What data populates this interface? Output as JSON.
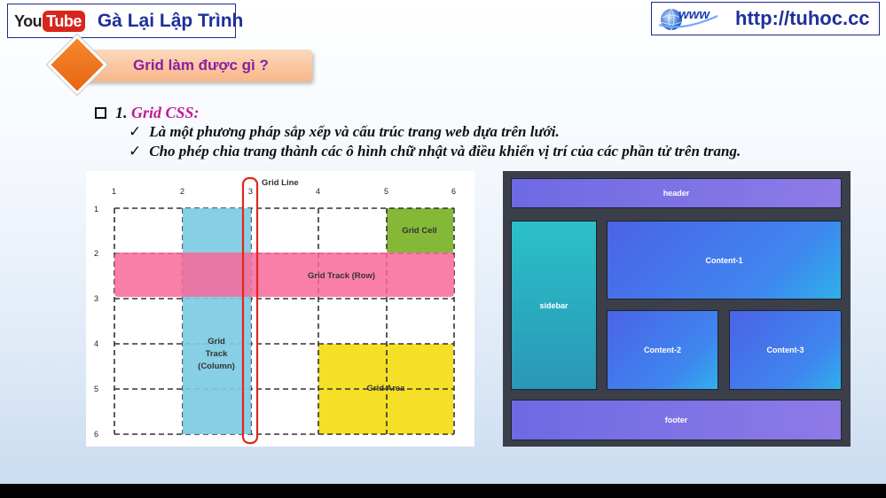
{
  "header": {
    "youtube_you": "You",
    "youtube_tube": "Tube",
    "channel_name": "Gà Lại Lập Trình",
    "www_text": "www",
    "url": "http://tuhoc.cc"
  },
  "section": {
    "title": "Grid làm được gì ?"
  },
  "content": {
    "heading_number": "1.",
    "heading": "Grid CSS:",
    "checkmark": "✓",
    "bullets": [
      "Là một phương pháp sắp xếp và cấu trúc trang web dựa trên lưới.",
      "Cho phép chia trang thành các ô hình chữ nhật và điều khiển vị trí của các phần tử trên trang."
    ]
  },
  "grid_diagram": {
    "column_numbers": [
      "1",
      "2",
      "3",
      "4",
      "5",
      "6"
    ],
    "row_numbers": [
      "1",
      "2",
      "3",
      "4",
      "5",
      "6"
    ],
    "grid_line_label": "Grid Line",
    "grid_cell_label": "Grid Cell",
    "grid_track_row_label": "Grid Track (Row)",
    "grid_track_column_lines": [
      "Grid",
      "Track",
      "(Column)"
    ],
    "grid_area_label": "Grid Area",
    "colors": {
      "column_track": "#7dcbe3",
      "row_track": "#f8699a",
      "grid_cell": "#86b838",
      "grid_area": "#f5df27",
      "highlight": "#e0281c"
    }
  },
  "layout_demo": {
    "header": "header",
    "sidebar": "sidebar",
    "content1": "Content-1",
    "content2": "Content-2",
    "content3": "Content-3",
    "footer": "footer"
  }
}
